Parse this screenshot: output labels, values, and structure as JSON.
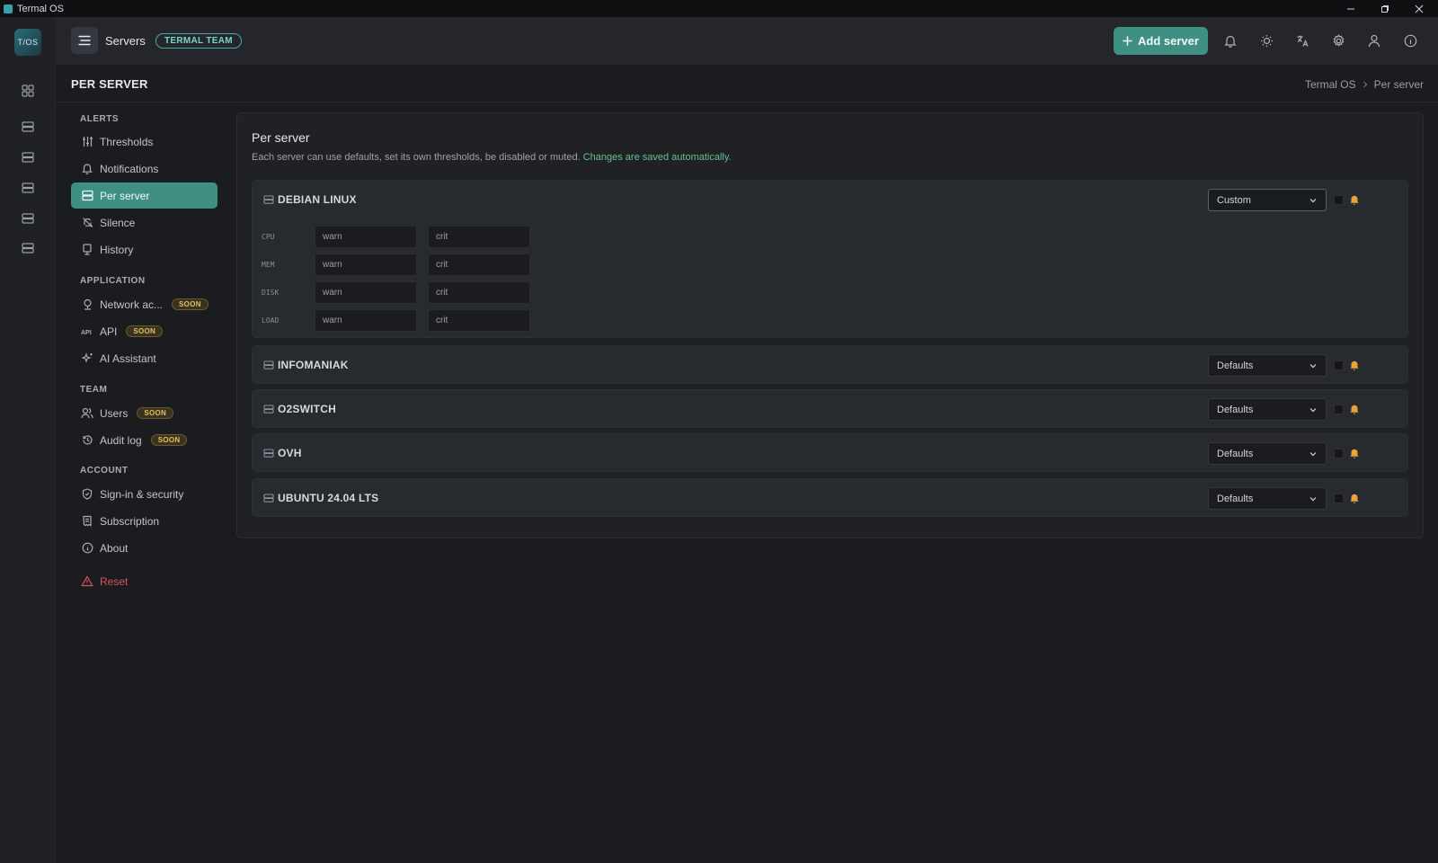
{
  "window": {
    "title": "Termal OS"
  },
  "rail": {
    "logo": "T/OS",
    "items": [
      "dashboard-icon",
      "server-icon",
      "server-icon",
      "server-icon",
      "server-icon",
      "server-icon"
    ]
  },
  "header": {
    "title": "Servers",
    "team_badge": "TERMAL TEAM",
    "add_button": "Add server",
    "icons": [
      "bell-icon",
      "sun-icon",
      "translate-icon",
      "gear-icon",
      "user-icon",
      "info-icon"
    ]
  },
  "page": {
    "title": "PER SERVER",
    "breadcrumb": [
      "Termal OS",
      "Per server"
    ]
  },
  "sidebar": {
    "sections": {
      "alerts": "ALERTS",
      "application": "APPLICATION",
      "team": "TEAM",
      "account": "ACCOUNT"
    },
    "items": {
      "thresholds": "Thresholds",
      "notifications": "Notifications",
      "per_server": "Per server",
      "silence": "Silence",
      "history": "History",
      "network": "Network ac...",
      "api": "API",
      "ai": "AI Assistant",
      "users": "Users",
      "audit": "Audit log",
      "signin": "Sign-in & security",
      "subscription": "Subscription",
      "about": "About",
      "reset": "Reset"
    },
    "soon_label": "SOON"
  },
  "main": {
    "title": "Per server",
    "description": "Each server can use defaults, set its own thresholds, be disabled or muted.",
    "description_ok": "Changes are saved automatically.",
    "servers": [
      {
        "name": "DEBIAN LINUX",
        "mode": "Custom",
        "metrics": [
          {
            "label": "CPU",
            "warn": "warn",
            "crit": "crit"
          },
          {
            "label": "MEM",
            "warn": "warn",
            "crit": "crit"
          },
          {
            "label": "DISK",
            "warn": "warn",
            "crit": "crit"
          },
          {
            "label": "LOAD",
            "warn": "warn",
            "crit": "crit"
          }
        ]
      },
      {
        "name": "INFOMANIAK",
        "mode": "Defaults"
      },
      {
        "name": "O2SWITCH",
        "mode": "Defaults"
      },
      {
        "name": "OVH",
        "mode": "Defaults"
      },
      {
        "name": "UBUNTU 24.04 LTS",
        "mode": "Defaults"
      }
    ]
  },
  "colors": {
    "accent": "#3f8f83",
    "success_text": "#67c08d",
    "danger": "#d9545e",
    "soon": "#e0c060",
    "bell": "#e8a33a"
  }
}
